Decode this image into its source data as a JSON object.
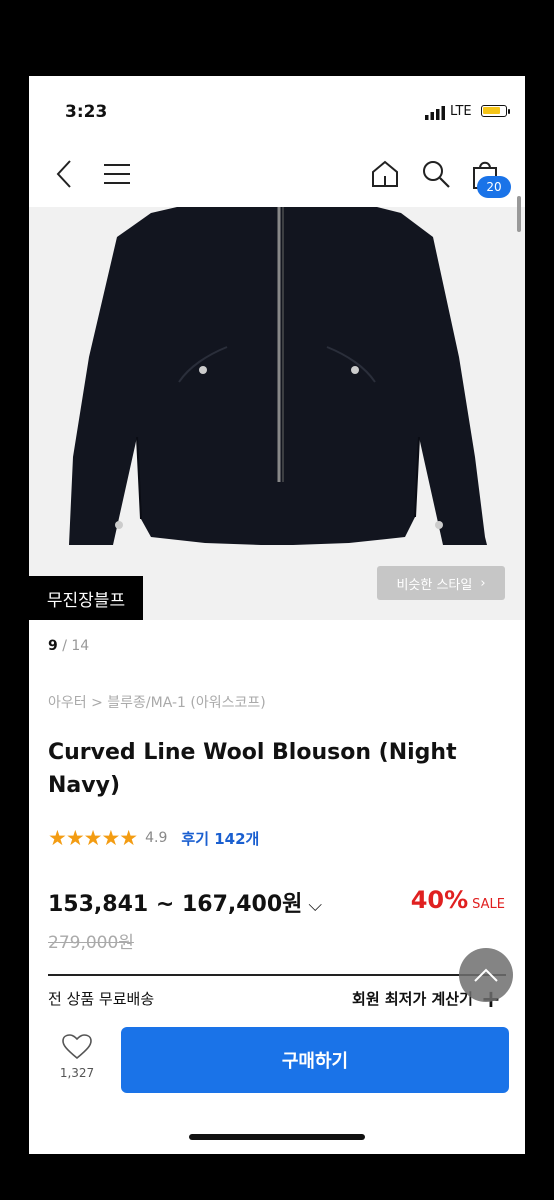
{
  "status_bar": {
    "time": "3:23",
    "network": "LTE"
  },
  "nav": {
    "cart_count": "20",
    "icons": [
      "back-icon",
      "menu-icon",
      "home-icon",
      "search-icon",
      "bag-icon"
    ]
  },
  "hero": {
    "brand_tag": "무진장블프",
    "similar_style": "비슷한 스타일"
  },
  "pager": {
    "current": "9",
    "total": "/ 14"
  },
  "product": {
    "breadcrumb": "아우터 > 블루종/MA-1 (아워스코프)",
    "title": "Curved Line Wool Blouson (Night Navy)",
    "stars": "★★★★★",
    "rating": "4.9",
    "reviews": "후기 142개",
    "price": "153,841 ~ 167,400원",
    "discount_pct": "40%",
    "discount_label": "SALE",
    "original_price": "279,000원"
  },
  "info": {
    "shipping": "전 상품 무료배송",
    "calculator": "회원 최저가 계산기"
  },
  "bottom": {
    "like_count": "1,327",
    "buy_label": "구매하기"
  },
  "colors": {
    "accent": "#1a73e8",
    "sale": "#e02020",
    "star": "#f39c12"
  }
}
